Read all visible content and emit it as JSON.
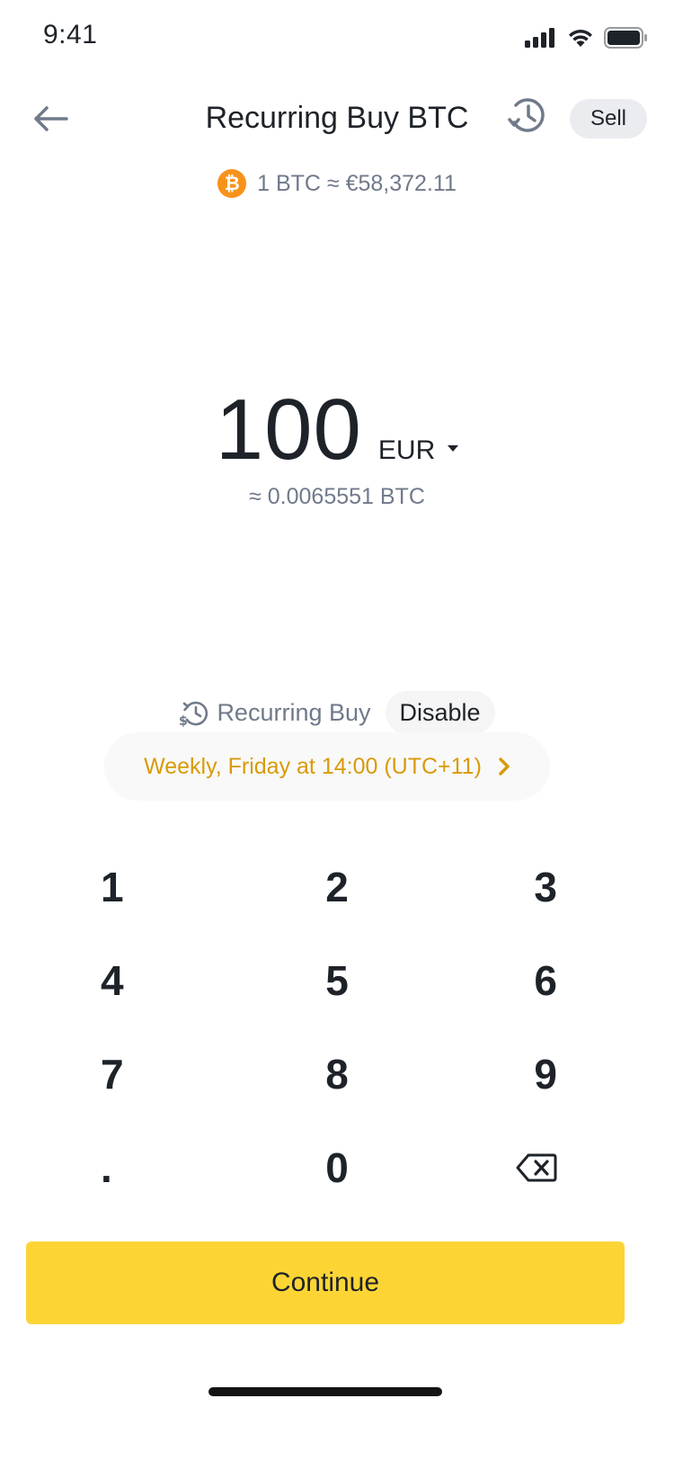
{
  "status_bar": {
    "time": "9:41"
  },
  "header": {
    "title": "Recurring Buy BTC",
    "sell_label": "Sell"
  },
  "price": {
    "coin_symbol": "₿",
    "text": "1 BTC ≈ €58,372.11"
  },
  "amount": {
    "value": "100",
    "currency": "EUR",
    "converted": "≈ 0.0065551 BTC"
  },
  "recurring": {
    "label": "Recurring Buy",
    "disable_label": "Disable",
    "schedule": "Weekly, Friday at 14:00 (UTC+11)"
  },
  "keypad": {
    "keys": [
      "1",
      "2",
      "3",
      "4",
      "5",
      "6",
      "7",
      "8",
      "9",
      ".",
      "0"
    ]
  },
  "continue_label": "Continue",
  "colors": {
    "accent_yellow": "#fcd535",
    "schedule_text": "#d99a09",
    "btc_orange": "#f7931a",
    "secondary_text": "#707a8a",
    "primary_text": "#1e2329"
  }
}
